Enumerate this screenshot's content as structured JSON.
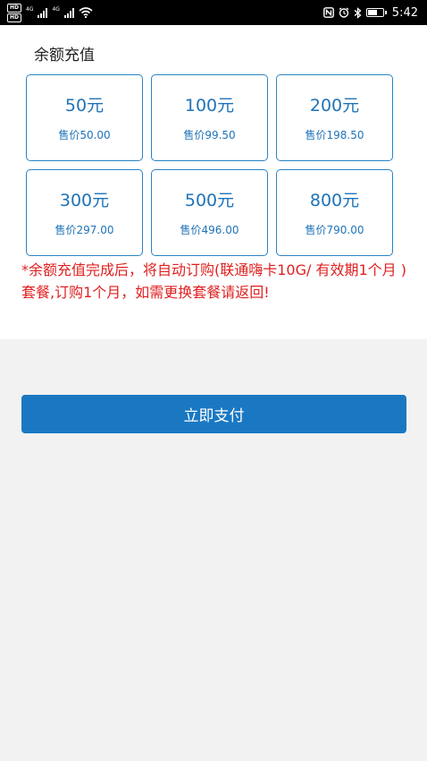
{
  "status_bar": {
    "badge_top": "HD",
    "badge_bottom": "HD",
    "net1": "4G",
    "net2": "4G",
    "time": "5:42",
    "battery_level": 0.7
  },
  "recharge": {
    "title": "余额充值",
    "packages": [
      {
        "amount": "50元",
        "price": "售价50.00"
      },
      {
        "amount": "100元",
        "price": "售价99.50"
      },
      {
        "amount": "200元",
        "price": "售价198.50"
      },
      {
        "amount": "300元",
        "price": "售价297.00"
      },
      {
        "amount": "500元",
        "price": "售价496.00"
      },
      {
        "amount": "800元",
        "price": "售价790.00"
      }
    ],
    "note": "*余额充值完成后，将自动订购(联通嗨卡10G/ 有效期1个月 )套餐,订购1个月，如需更换套餐请返回!"
  },
  "pay_button": {
    "label": "立即支付"
  },
  "colors": {
    "accent": "#1a78c2",
    "warning": "#e02020"
  }
}
